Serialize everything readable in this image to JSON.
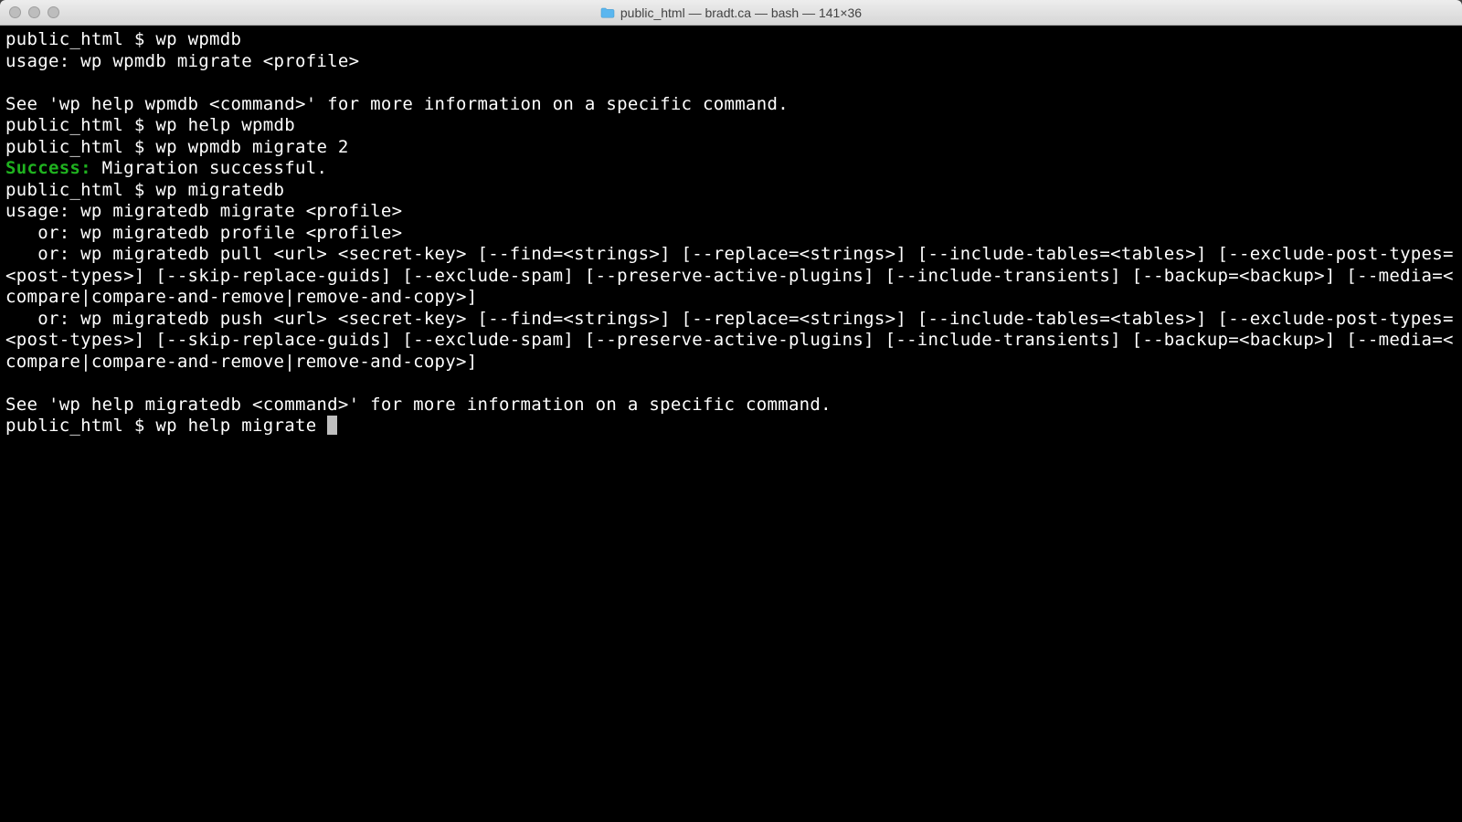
{
  "titlebar": {
    "title": "public_html — bradt.ca — bash — 141×36"
  },
  "terminal": {
    "prompt": "public_html $ ",
    "lines": {
      "l1_cmd": "wp wpmdb",
      "l2": "usage: wp wpmdb migrate <profile>",
      "l3": "",
      "l4": "See 'wp help wpmdb <command>' for more information on a specific command.",
      "l5_cmd": "wp help wpmdb",
      "l6_cmd": "wp wpmdb migrate 2",
      "l7_success": "Success:",
      "l7_rest": " Migration successful.",
      "l8_cmd": "wp migratedb",
      "l9": "usage: wp migratedb migrate <profile>",
      "l10": "   or: wp migratedb profile <profile>",
      "l11": "   or: wp migratedb pull <url> <secret-key> [--find=<strings>] [--replace=<strings>] [--include-tables=<tables>] [--exclude-post-types=<post-types>] [--skip-replace-guids] [--exclude-spam] [--preserve-active-plugins] [--include-transients] [--backup=<backup>] [--media=<compare|compare-and-remove|remove-and-copy>]",
      "l12": "   or: wp migratedb push <url> <secret-key> [--find=<strings>] [--replace=<strings>] [--include-tables=<tables>] [--exclude-post-types=<post-types>] [--skip-replace-guids] [--exclude-spam] [--preserve-active-plugins] [--include-transients] [--backup=<backup>] [--media=<compare|compare-and-remove|remove-and-copy>]",
      "l13": "",
      "l14": "See 'wp help migratedb <command>' for more information on a specific command.",
      "l15_cmd": "wp help migrate "
    }
  }
}
